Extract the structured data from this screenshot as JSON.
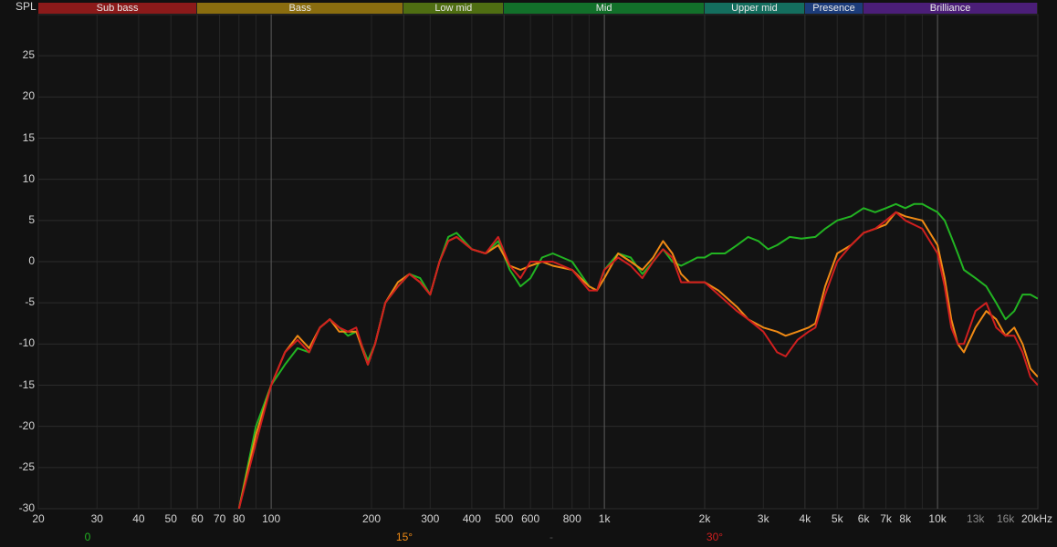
{
  "chart_data": {
    "type": "line",
    "ylabel": "SPL",
    "xscale": "log",
    "xlim": [
      20,
      20000
    ],
    "ylim": [
      -30,
      30
    ],
    "grid": true,
    "bands": [
      {
        "label": "Sub bass",
        "from": 20,
        "to": 60,
        "color": "#8b1a1a"
      },
      {
        "label": "Bass",
        "from": 60,
        "to": 250,
        "color": "#8a6d0f"
      },
      {
        "label": "Low mid",
        "from": 250,
        "to": 500,
        "color": "#4f6e12"
      },
      {
        "label": "Mid",
        "from": 500,
        "to": 2000,
        "color": "#12702a"
      },
      {
        "label": "Upper mid",
        "from": 2000,
        "to": 4000,
        "color": "#146e5e"
      },
      {
        "label": "Presence",
        "from": 4000,
        "to": 6000,
        "color": "#1c3c7a"
      },
      {
        "label": "Brilliance",
        "from": 6000,
        "to": 20000,
        "color": "#4b1e78"
      }
    ],
    "yticks": [
      25,
      20,
      15,
      10,
      5,
      0,
      -5,
      -10,
      -15,
      -20,
      -25,
      -30
    ],
    "xticks": [
      {
        "v": 20,
        "label": "20",
        "dim": false
      },
      {
        "v": 30,
        "label": "30",
        "dim": false
      },
      {
        "v": 40,
        "label": "40",
        "dim": false
      },
      {
        "v": 50,
        "label": "50",
        "dim": false
      },
      {
        "v": 60,
        "label": "60",
        "dim": false
      },
      {
        "v": 70,
        "label": "70",
        "dim": false
      },
      {
        "v": 80,
        "label": "80",
        "dim": false
      },
      {
        "v": 100,
        "label": "100",
        "dim": false
      },
      {
        "v": 200,
        "label": "200",
        "dim": false
      },
      {
        "v": 300,
        "label": "300",
        "dim": false
      },
      {
        "v": 400,
        "label": "400",
        "dim": false
      },
      {
        "v": 500,
        "label": "500",
        "dim": false
      },
      {
        "v": 600,
        "label": "600",
        "dim": false
      },
      {
        "v": 800,
        "label": "800",
        "dim": false
      },
      {
        "v": 1000,
        "label": "1k",
        "dim": false
      },
      {
        "v": 2000,
        "label": "2k",
        "dim": false
      },
      {
        "v": 3000,
        "label": "3k",
        "dim": false
      },
      {
        "v": 4000,
        "label": "4k",
        "dim": false
      },
      {
        "v": 5000,
        "label": "5k",
        "dim": false
      },
      {
        "v": 6000,
        "label": "6k",
        "dim": false
      },
      {
        "v": 7000,
        "label": "7k",
        "dim": false
      },
      {
        "v": 8000,
        "label": "8k",
        "dim": false
      },
      {
        "v": 10000,
        "label": "10k",
        "dim": false
      },
      {
        "v": 13000,
        "label": "13k",
        "dim": true
      },
      {
        "v": 16000,
        "label": "16k",
        "dim": true
      },
      {
        "v": 20000,
        "label": "20kHz",
        "dim": false
      }
    ],
    "major_lines": [
      100,
      1000,
      10000
    ],
    "legend": [
      {
        "label": "0",
        "color": "#22b422",
        "x": 20
      },
      {
        "label": "15°",
        "color": "#f08a14",
        "x": 1000
      },
      {
        "label": "-",
        "color": "#555555",
        "x": 1000
      },
      {
        "label": "30°",
        "color": "#d01f1f",
        "x": 2000
      }
    ],
    "series": [
      {
        "name": "0",
        "color": "#22b422",
        "points": [
          [
            80,
            -30
          ],
          [
            90,
            -20
          ],
          [
            100,
            -15
          ],
          [
            110,
            -12.5
          ],
          [
            120,
            -10.5
          ],
          [
            130,
            -11
          ],
          [
            140,
            -8
          ],
          [
            150,
            -7
          ],
          [
            160,
            -8
          ],
          [
            170,
            -9
          ],
          [
            180,
            -8.5
          ],
          [
            195,
            -12
          ],
          [
            205,
            -10
          ],
          [
            220,
            -5
          ],
          [
            240,
            -3
          ],
          [
            260,
            -1.5
          ],
          [
            280,
            -2
          ],
          [
            300,
            -4
          ],
          [
            320,
            0
          ],
          [
            340,
            3
          ],
          [
            360,
            3.5
          ],
          [
            400,
            1.5
          ],
          [
            440,
            1
          ],
          [
            480,
            2.5
          ],
          [
            520,
            -1
          ],
          [
            560,
            -3
          ],
          [
            600,
            -2
          ],
          [
            650,
            0.5
          ],
          [
            700,
            1
          ],
          [
            800,
            0
          ],
          [
            900,
            -3
          ],
          [
            950,
            -3.5
          ],
          [
            1000,
            -1
          ],
          [
            1100,
            1
          ],
          [
            1200,
            0.5
          ],
          [
            1300,
            -1.5
          ],
          [
            1400,
            0
          ],
          [
            1500,
            1.5
          ],
          [
            1600,
            0
          ],
          [
            1700,
            -0.5
          ],
          [
            1800,
            0
          ],
          [
            1900,
            0.5
          ],
          [
            2000,
            0.5
          ],
          [
            2100,
            1
          ],
          [
            2300,
            1
          ],
          [
            2500,
            2
          ],
          [
            2700,
            3
          ],
          [
            2900,
            2.5
          ],
          [
            3100,
            1.5
          ],
          [
            3300,
            2
          ],
          [
            3600,
            3
          ],
          [
            3900,
            2.8
          ],
          [
            4300,
            3
          ],
          [
            4600,
            4
          ],
          [
            5000,
            5
          ],
          [
            5500,
            5.5
          ],
          [
            6000,
            6.5
          ],
          [
            6500,
            6
          ],
          [
            7000,
            6.5
          ],
          [
            7500,
            7
          ],
          [
            8000,
            6.5
          ],
          [
            8500,
            7
          ],
          [
            9000,
            7
          ],
          [
            10000,
            6
          ],
          [
            10500,
            5
          ],
          [
            11000,
            3
          ],
          [
            11500,
            1
          ],
          [
            12000,
            -1
          ],
          [
            13000,
            -2
          ],
          [
            14000,
            -3
          ],
          [
            15000,
            -5
          ],
          [
            16000,
            -7
          ],
          [
            17000,
            -6
          ],
          [
            18000,
            -4
          ],
          [
            19000,
            -4
          ],
          [
            20000,
            -4.5
          ]
        ]
      },
      {
        "name": "15°",
        "color": "#f08a14",
        "points": [
          [
            80,
            -30
          ],
          [
            90,
            -21
          ],
          [
            100,
            -15
          ],
          [
            110,
            -11
          ],
          [
            120,
            -9
          ],
          [
            130,
            -10.5
          ],
          [
            140,
            -8
          ],
          [
            150,
            -7
          ],
          [
            160,
            -8.5
          ],
          [
            170,
            -8.5
          ],
          [
            180,
            -8.5
          ],
          [
            195,
            -12.5
          ],
          [
            205,
            -10
          ],
          [
            220,
            -5
          ],
          [
            240,
            -2.5
          ],
          [
            260,
            -1.5
          ],
          [
            280,
            -2.5
          ],
          [
            300,
            -4
          ],
          [
            320,
            0
          ],
          [
            340,
            2.5
          ],
          [
            360,
            3
          ],
          [
            400,
            1.5
          ],
          [
            440,
            1
          ],
          [
            480,
            2
          ],
          [
            520,
            -0.5
          ],
          [
            560,
            -1
          ],
          [
            600,
            -0.5
          ],
          [
            650,
            0
          ],
          [
            700,
            -0.5
          ],
          [
            800,
            -1
          ],
          [
            900,
            -3
          ],
          [
            950,
            -3.5
          ],
          [
            1000,
            -2
          ],
          [
            1100,
            1
          ],
          [
            1200,
            0
          ],
          [
            1300,
            -1
          ],
          [
            1400,
            0.5
          ],
          [
            1500,
            2.5
          ],
          [
            1600,
            1
          ],
          [
            1700,
            -1.5
          ],
          [
            1800,
            -2.5
          ],
          [
            1900,
            -2.5
          ],
          [
            2000,
            -2.5
          ],
          [
            2200,
            -3.5
          ],
          [
            2500,
            -5.5
          ],
          [
            2700,
            -7
          ],
          [
            3000,
            -8
          ],
          [
            3300,
            -8.5
          ],
          [
            3500,
            -9
          ],
          [
            3800,
            -8.5
          ],
          [
            4100,
            -8
          ],
          [
            4300,
            -7.5
          ],
          [
            4600,
            -3
          ],
          [
            5000,
            1
          ],
          [
            5500,
            2
          ],
          [
            6000,
            3.5
          ],
          [
            6500,
            4
          ],
          [
            7000,
            4.5
          ],
          [
            7500,
            6
          ],
          [
            8000,
            5.5
          ],
          [
            9000,
            5
          ],
          [
            10000,
            2
          ],
          [
            10500,
            -2
          ],
          [
            11000,
            -7
          ],
          [
            11500,
            -10
          ],
          [
            12000,
            -11
          ],
          [
            13000,
            -8
          ],
          [
            14000,
            -6
          ],
          [
            15000,
            -7
          ],
          [
            16000,
            -9
          ],
          [
            17000,
            -8
          ],
          [
            18000,
            -10
          ],
          [
            19000,
            -13
          ],
          [
            20000,
            -14
          ]
        ]
      },
      {
        "name": "30°",
        "color": "#d01f1f",
        "points": [
          [
            80,
            -30
          ],
          [
            90,
            -22
          ],
          [
            100,
            -15
          ],
          [
            110,
            -11
          ],
          [
            120,
            -9.5
          ],
          [
            130,
            -11
          ],
          [
            140,
            -8
          ],
          [
            150,
            -7
          ],
          [
            160,
            -8
          ],
          [
            170,
            -8.5
          ],
          [
            180,
            -8
          ],
          [
            195,
            -12.5
          ],
          [
            205,
            -10
          ],
          [
            220,
            -5
          ],
          [
            240,
            -3
          ],
          [
            260,
            -1.5
          ],
          [
            280,
            -2.5
          ],
          [
            300,
            -4
          ],
          [
            320,
            0
          ],
          [
            340,
            2.5
          ],
          [
            360,
            3
          ],
          [
            400,
            1.5
          ],
          [
            440,
            1
          ],
          [
            480,
            3
          ],
          [
            520,
            -0.5
          ],
          [
            560,
            -2
          ],
          [
            600,
            0
          ],
          [
            650,
            0
          ],
          [
            700,
            0
          ],
          [
            800,
            -1
          ],
          [
            900,
            -3.5
          ],
          [
            950,
            -3.5
          ],
          [
            1000,
            -1
          ],
          [
            1100,
            0.5
          ],
          [
            1200,
            -0.5
          ],
          [
            1300,
            -2
          ],
          [
            1400,
            0
          ],
          [
            1500,
            1.5
          ],
          [
            1600,
            0.5
          ],
          [
            1700,
            -2.5
          ],
          [
            1800,
            -2.5
          ],
          [
            1900,
            -2.5
          ],
          [
            2000,
            -2.5
          ],
          [
            2200,
            -4
          ],
          [
            2500,
            -6
          ],
          [
            2700,
            -7
          ],
          [
            3000,
            -8.5
          ],
          [
            3300,
            -11
          ],
          [
            3500,
            -11.5
          ],
          [
            3800,
            -9.5
          ],
          [
            4100,
            -8.5
          ],
          [
            4300,
            -8
          ],
          [
            4600,
            -4
          ],
          [
            5000,
            0
          ],
          [
            5500,
            2
          ],
          [
            6000,
            3.5
          ],
          [
            6500,
            4
          ],
          [
            7000,
            5
          ],
          [
            7500,
            6
          ],
          [
            8000,
            5
          ],
          [
            9000,
            4
          ],
          [
            10000,
            1
          ],
          [
            10500,
            -3
          ],
          [
            11000,
            -8
          ],
          [
            11500,
            -10
          ],
          [
            12000,
            -10
          ],
          [
            13000,
            -6
          ],
          [
            14000,
            -5
          ],
          [
            15000,
            -8
          ],
          [
            16000,
            -9
          ],
          [
            17000,
            -9
          ],
          [
            18000,
            -11
          ],
          [
            19000,
            -14
          ],
          [
            20000,
            -15
          ]
        ]
      }
    ]
  }
}
